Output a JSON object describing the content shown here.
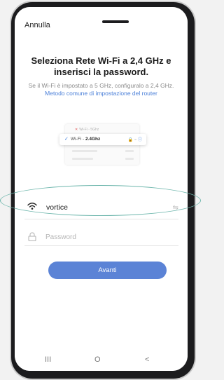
{
  "header": {
    "cancel_label": "Annulla"
  },
  "main": {
    "title": "Seleziona Rete Wi-Fi a 2,4 GHz e inserisci la password.",
    "subtitle_text": "Se il Wi-Fi è impostato a 5 GHz, configuralo a 2,4 GHz. ",
    "subtitle_link": "Metodo comune di impostazione del router"
  },
  "illustration": {
    "row_5ghz_label": "Wi-Fi - 5Ghz",
    "row_24ghz_prefix": "Wi-Fi - ",
    "row_24ghz_band": "2.4Ghz",
    "x_mark": "✕",
    "check_mark": "✓",
    "status_icons": "🔒 ≈ ",
    "info_icon": "ⓘ"
  },
  "form": {
    "wifi_ssid": "vortice",
    "swap_icon": "⇋",
    "password_placeholder": "Password",
    "submit_label": "Avanti"
  },
  "navbar": {
    "recents": "III",
    "home": "O",
    "back": "<"
  },
  "colors": {
    "accent": "#5b83d6",
    "link": "#4a7fd8",
    "highlight_ellipse": "#6fb7ad"
  }
}
